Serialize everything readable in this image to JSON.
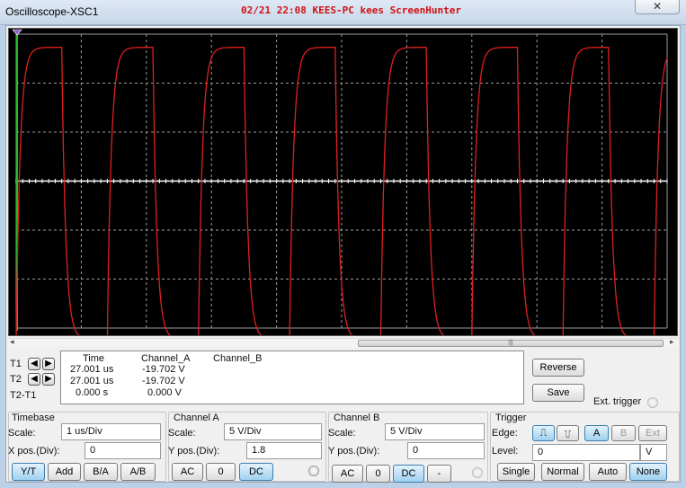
{
  "window": {
    "title": "Oscilloscope-XSC1",
    "overlay": "02/21 22:08 KEES-PC kees ScreenHunter",
    "close": "✕"
  },
  "screen": {
    "background": "#000000",
    "grid_color": "#9a9a9a",
    "trace_color": "#e02020",
    "axis_color": "#ffffff",
    "cursor_color": "#22c022"
  },
  "chart_data": {
    "type": "line",
    "title": "",
    "xlabel": "",
    "ylabel": "",
    "x_unit": "us",
    "y_unit": "V",
    "xlim": [
      0,
      10
    ],
    "ylim": [
      -20,
      20
    ],
    "grid": true,
    "series": [
      {
        "channel": "A",
        "waveform": "square wave with exponential rise/fall (RC response)",
        "period_us": 1.4,
        "high_v": 18.2,
        "low_v": -21.5,
        "first_rise_us": 0.0,
        "duty": 0.5,
        "time_constant_us": 0.06
      }
    ]
  },
  "cursors": {
    "t1_label": "T1",
    "t2_label": "T2",
    "t2t1_label": "T2-T1",
    "left_arrow": "🡄",
    "right_arrow": "🡆",
    "headers": [
      "Time",
      "Channel_A",
      "Channel_B"
    ],
    "rows": [
      [
        "27.001 us",
        "-19.702 V",
        ""
      ],
      [
        "27.001 us",
        "-19.702 V",
        ""
      ],
      [
        "0.000 s",
        "0.000 V",
        ""
      ]
    ]
  },
  "side_buttons": {
    "reverse": "Reverse",
    "save": "Save",
    "ext_trigger": "Ext. trigger"
  },
  "timebase": {
    "title": "Timebase",
    "scale_label": "Scale:",
    "scale_value": "1 us/Div",
    "xpos_label": "X pos.(Div):",
    "xpos_value": "0",
    "buttons": [
      "Y/T",
      "Add",
      "B/A",
      "A/B"
    ],
    "active": "Y/T"
  },
  "channel_a": {
    "title": "Channel A",
    "scale_label": "Scale:",
    "scale_value": "5  V/Div",
    "ypos_label": "Y pos.(Div):",
    "ypos_value": "1.8",
    "buttons": [
      "AC",
      "0",
      "DC"
    ],
    "active": "DC"
  },
  "channel_b": {
    "title": "Channel B",
    "scale_label": "Scale:",
    "scale_value": "5  V/Div",
    "ypos_label": "Y pos.(Div):",
    "ypos_value": "0",
    "buttons": [
      "AC",
      "0",
      "DC",
      "-"
    ],
    "active": "DC"
  },
  "trigger": {
    "title": "Trigger",
    "edge_label": "Edge:",
    "edge_rise": "⎍",
    "edge_fall": "⎍",
    "sources": [
      "A",
      "B",
      "Ext"
    ],
    "active_source": "A",
    "level_label": "Level:",
    "level_value": "0",
    "level_unit": "V",
    "modes": [
      "Single",
      "Normal",
      "Auto",
      "None"
    ],
    "active_mode": "None"
  }
}
